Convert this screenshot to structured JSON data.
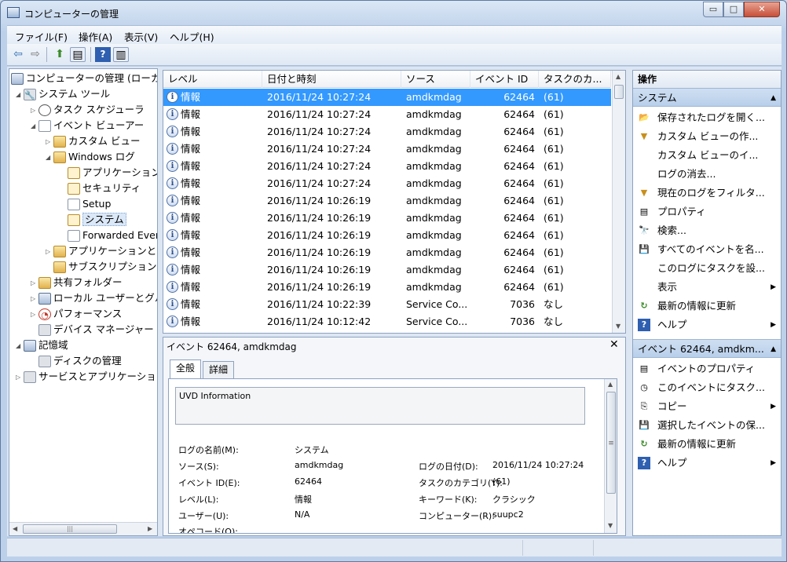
{
  "window": {
    "title": "コンピューターの管理"
  },
  "window_buttons": {
    "minimize": "▭",
    "maximize": "□",
    "close": "✕"
  },
  "menu": [
    "ファイル(F)",
    "操作(A)",
    "表示(V)",
    "ヘルプ(H)"
  ],
  "toolbar": {
    "back": "⇦",
    "forward": "⇨",
    "up": "⬆",
    "showhide": "▤",
    "help": "?",
    "pane": "▥"
  },
  "tree": {
    "root": "コンピューターの管理 (ローカル)",
    "system_tools": "システム ツール",
    "task_scheduler": "タスク スケジューラ",
    "event_viewer": "イベント ビューアー",
    "custom_views": "カスタム ビュー",
    "windows_logs": "Windows ログ",
    "application": "アプリケーション",
    "security": "セキュリティ",
    "setup": "Setup",
    "system": "システム",
    "forwarded": "Forwarded Events",
    "apps_services": "アプリケーションとサービス ログ",
    "subscriptions": "サブスクリプション",
    "shared_folders": "共有フォルダー",
    "local_users": "ローカル ユーザーとグループ",
    "performance": "パフォーマンス",
    "device_manager": "デバイス マネージャー",
    "storage": "記憶域",
    "disk_management": "ディスクの管理",
    "services_apps": "サービスとアプリケーション",
    "scroll_grip": "|||"
  },
  "event_list": {
    "columns": [
      "レベル",
      "日付と時刻",
      "ソース",
      "イベント ID",
      "タスクのカ..."
    ],
    "rows": [
      {
        "level": "情報",
        "datetime": "2016/11/24 10:27:24",
        "source": "amdkmdag",
        "id": "62464",
        "task": "(61)"
      },
      {
        "level": "情報",
        "datetime": "2016/11/24 10:27:24",
        "source": "amdkmdag",
        "id": "62464",
        "task": "(61)"
      },
      {
        "level": "情報",
        "datetime": "2016/11/24 10:27:24",
        "source": "amdkmdag",
        "id": "62464",
        "task": "(61)"
      },
      {
        "level": "情報",
        "datetime": "2016/11/24 10:27:24",
        "source": "amdkmdag",
        "id": "62464",
        "task": "(61)"
      },
      {
        "level": "情報",
        "datetime": "2016/11/24 10:27:24",
        "source": "amdkmdag",
        "id": "62464",
        "task": "(61)"
      },
      {
        "level": "情報",
        "datetime": "2016/11/24 10:27:24",
        "source": "amdkmdag",
        "id": "62464",
        "task": "(61)"
      },
      {
        "level": "情報",
        "datetime": "2016/11/24 10:26:19",
        "source": "amdkmdag",
        "id": "62464",
        "task": "(61)"
      },
      {
        "level": "情報",
        "datetime": "2016/11/24 10:26:19",
        "source": "amdkmdag",
        "id": "62464",
        "task": "(61)"
      },
      {
        "level": "情報",
        "datetime": "2016/11/24 10:26:19",
        "source": "amdkmdag",
        "id": "62464",
        "task": "(61)"
      },
      {
        "level": "情報",
        "datetime": "2016/11/24 10:26:19",
        "source": "amdkmdag",
        "id": "62464",
        "task": "(61)"
      },
      {
        "level": "情報",
        "datetime": "2016/11/24 10:26:19",
        "source": "amdkmdag",
        "id": "62464",
        "task": "(61)"
      },
      {
        "level": "情報",
        "datetime": "2016/11/24 10:26:19",
        "source": "amdkmdag",
        "id": "62464",
        "task": "(61)"
      },
      {
        "level": "情報",
        "datetime": "2016/11/24 10:22:39",
        "source": "Service Co...",
        "id": "7036",
        "task": "なし"
      },
      {
        "level": "情報",
        "datetime": "2016/11/24 10:12:42",
        "source": "Service Co...",
        "id": "7036",
        "task": "なし"
      }
    ]
  },
  "detail": {
    "title": "イベント 62464, amdkmdag",
    "close": "✕",
    "tabs": [
      "全般",
      "詳細"
    ],
    "description": "UVD Information",
    "labels": {
      "log_name": "ログの名前(M):",
      "source": "ソース(S):",
      "event_id": "イベント ID(E):",
      "level": "レベル(L):",
      "user": "ユーザー(U):",
      "opcode": "オペコード(O):",
      "logged": "ログの日付(D):",
      "task_category": "タスクのカテゴリ(Y):",
      "keywords": "キーワード(K):",
      "computer": "コンピューター(R):"
    },
    "values": {
      "log_name": "システム",
      "source": "amdkmdag",
      "event_id": "62464",
      "level": "情報",
      "user": "N/A",
      "logged": "2016/11/24 10:27:24",
      "task_category": "(61)",
      "keywords": "クラシック",
      "computer": "suupc2"
    },
    "scroll_grip": "≡"
  },
  "actions": {
    "header": "操作",
    "section1": "システム",
    "items1": [
      {
        "label": "保存されたログを開く...",
        "icon": "folder-open-icon"
      },
      {
        "label": "カスタム ビューの作...",
        "icon": "filter-icon"
      },
      {
        "label": "カスタム ビューのイ...",
        "icon": ""
      },
      {
        "label": "ログの消去...",
        "icon": ""
      },
      {
        "label": "現在のログをフィルタ...",
        "icon": "filter-icon"
      },
      {
        "label": "プロパティ",
        "icon": "properties-icon"
      },
      {
        "label": "検索...",
        "icon": "binoculars-icon"
      },
      {
        "label": "すべてのイベントを名...",
        "icon": "save-icon"
      },
      {
        "label": "このログにタスクを設...",
        "icon": ""
      },
      {
        "label": "表示",
        "icon": "",
        "submenu": true
      },
      {
        "label": "最新の情報に更新",
        "icon": "refresh-icon"
      },
      {
        "label": "ヘルプ",
        "icon": "help-icon",
        "submenu": true
      }
    ],
    "section2": "イベント 62464, amdkm...",
    "items2": [
      {
        "label": "イベントのプロパティ",
        "icon": "properties-icon"
      },
      {
        "label": "このイベントにタスク...",
        "icon": "task-icon"
      },
      {
        "label": "コピー",
        "icon": "copy-icon",
        "submenu": true
      },
      {
        "label": "選択したイベントの保...",
        "icon": "save-icon"
      },
      {
        "label": "最新の情報に更新",
        "icon": "refresh-icon"
      },
      {
        "label": "ヘルプ",
        "icon": "help-icon",
        "submenu": true
      }
    ]
  }
}
